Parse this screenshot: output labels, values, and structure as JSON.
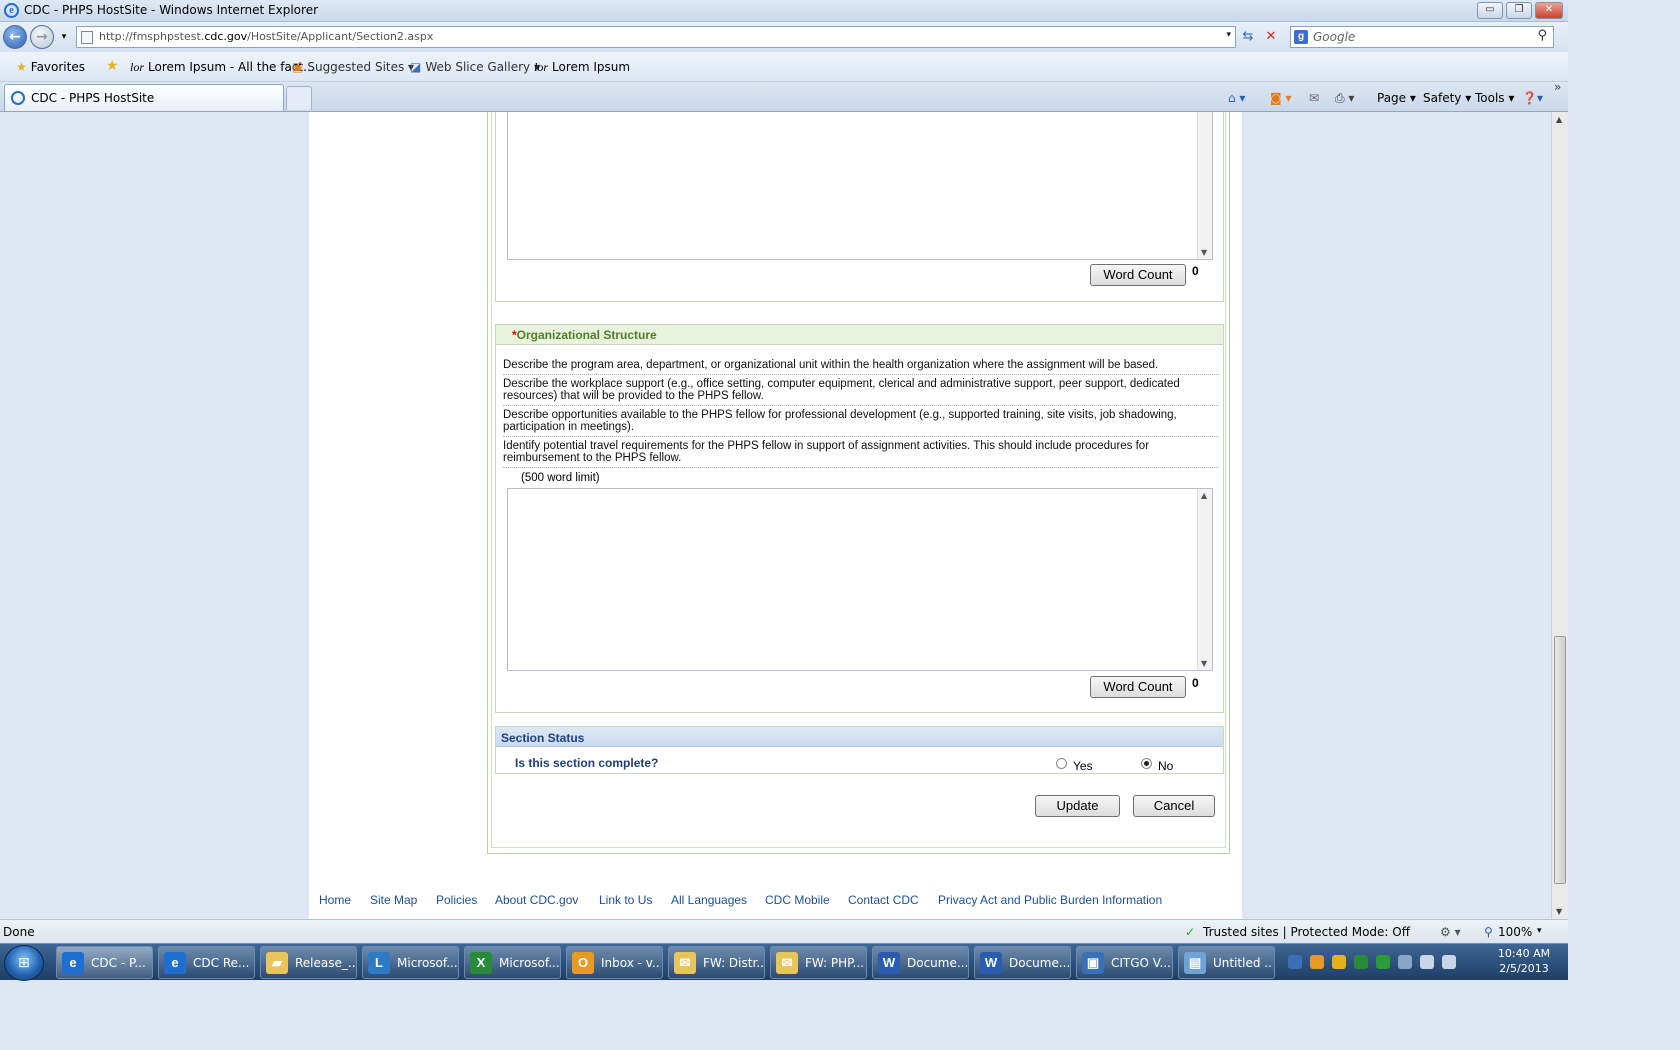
{
  "window": {
    "title": "CDC - PHPS HostSite - Windows Internet Explorer",
    "min_glyph": "▭",
    "restore_glyph": "❐",
    "close_glyph": "✕"
  },
  "address": {
    "url_prefix": "http://fmsphpstest.",
    "url_domain": "cdc.gov",
    "url_path": "/HostSite/Applicant/Section2.aspx",
    "search_placeholder": "Google"
  },
  "favorites": {
    "favorites_label": "Favorites",
    "items": [
      "Lorem Ipsum - All the fact...",
      "Suggested Sites ▾",
      "Web Slice Gallery ▾",
      "Lorem Ipsum"
    ]
  },
  "tabs": [
    {
      "label": "CDC - PHPS HostSite"
    }
  ],
  "command_bar": {
    "page": "Page ▾",
    "safety": "Safety ▾",
    "tools": "Tools ▾"
  },
  "form": {
    "word_count_label": "Word Count",
    "section1": {
      "word_count": "0"
    },
    "section2": {
      "required_mark": "*",
      "title": "Organizational Structure",
      "descriptions": [
        "Describe the program area, department, or organizational unit within the health organization where the assignment will be based.",
        "Describe the workplace support (e.g., office setting, computer equipment, clerical and administrative support, peer support, dedicated resources) that will be provided to the PHPS fellow.",
        "Describe opportunities available to the PHPS fellow for professional development (e.g., supported training, site visits, job shadowing, participation in meetings).",
        "Identify potential travel requirements for the PHPS fellow in support of assignment activities. This should include procedures for reimbursement to the PHPS fellow."
      ],
      "word_limit": "(500 word limit)",
      "word_count": "0"
    },
    "section_status": {
      "title": "Section Status",
      "question": "Is this section complete?",
      "options": [
        "Yes",
        "No"
      ],
      "selected": "No"
    },
    "update_label": "Update",
    "cancel_label": "Cancel"
  },
  "footer_links": [
    "Home",
    "Site Map",
    "Policies",
    "About CDC.gov",
    "Link to Us",
    "All Languages",
    "CDC Mobile",
    "Contact CDC",
    "Privacy Act and Public Burden Information"
  ],
  "status_bar": {
    "left": "Done",
    "zone": "Trusted sites | Protected Mode: Off",
    "zoom": "100%"
  },
  "taskbar": {
    "items": [
      {
        "label": "CDC - P...",
        "icon": "ie-icon",
        "color": "#1f6fd0"
      },
      {
        "label": "CDC Re...",
        "icon": "ie-icon",
        "color": "#1f6fd0"
      },
      {
        "label": "Release_...",
        "icon": "folder-icon",
        "color": "#e8c45c"
      },
      {
        "label": "Microsof...",
        "icon": "lync-icon",
        "color": "#2f7ac4"
      },
      {
        "label": "Microsof...",
        "icon": "excel-icon",
        "color": "#2a8a3c"
      },
      {
        "label": "Inbox - v...",
        "icon": "outlook-icon",
        "color": "#e79a24"
      },
      {
        "label": "FW: Distr...",
        "icon": "mail-icon",
        "color": "#e8c45c"
      },
      {
        "label": "FW: PHP...",
        "icon": "mail-icon",
        "color": "#e8c45c"
      },
      {
        "label": "Docume...",
        "icon": "word-icon",
        "color": "#2b5caf"
      },
      {
        "label": "Docume...",
        "icon": "word-icon",
        "color": "#2b5caf"
      },
      {
        "label": "CITGO V...",
        "icon": "remote-desktop-icon",
        "color": "#3a70b8"
      },
      {
        "label": "Untitled ...",
        "icon": "notepad-icon",
        "color": "#6fa3d4"
      }
    ],
    "time": "10:40 AM",
    "date": "2/5/2013"
  }
}
